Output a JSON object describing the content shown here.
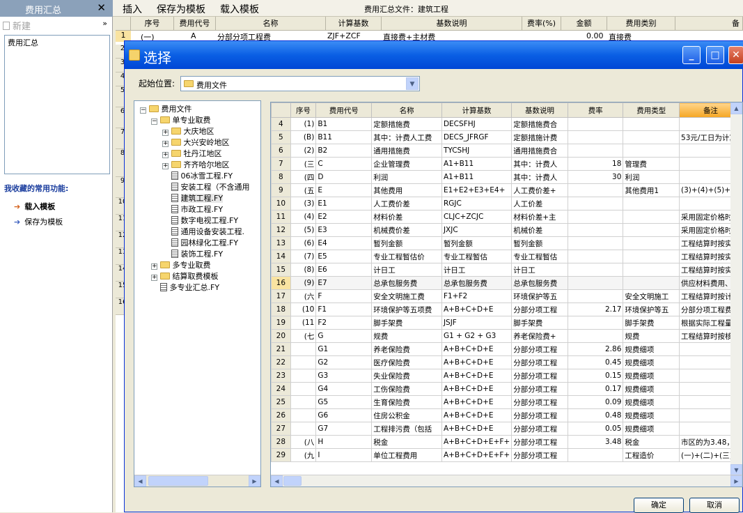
{
  "left_pane": {
    "title": "费用汇总",
    "close": "✕",
    "new_label": "新建",
    "more": "»",
    "tree_item": "费用汇总",
    "fav_title": "我收藏的常用功能:",
    "fav_items": [
      "载入模板",
      "保存为模板"
    ]
  },
  "toolbar": {
    "insert": "插入",
    "save_template": "保存为模板",
    "load_template": "载入模板",
    "doc_title": "费用汇总文件：建筑工程"
  },
  "bg_grid": {
    "headers": [
      "序号",
      "费用代号",
      "名称",
      "计算基数",
      "基数说明",
      "费率(%)",
      "金额",
      "费用类别",
      "备"
    ],
    "first_row": [
      "(一)",
      "A",
      "分部分项工程费",
      "ZJF+ZCF",
      "直接费+主材费",
      "",
      "0.00",
      "直接费"
    ],
    "row_numbers": [
      "1",
      "2",
      "3",
      "4",
      "5",
      "6",
      "7",
      "8",
      "9",
      "10",
      "11",
      "12",
      "13",
      "14",
      "15",
      "16"
    ]
  },
  "dialog": {
    "title": "选择",
    "start_label": "起始位置:",
    "start_value": "费用文件",
    "ok": "确定",
    "cancel": "取消",
    "tree": [
      {
        "label": "费用文件",
        "kind": "folder",
        "exp": "−"
      },
      {
        "label": "单专业取费",
        "kind": "folder",
        "exp": "−"
      },
      {
        "label": "大庆地区",
        "kind": "folder",
        "exp": "+"
      },
      {
        "label": "大兴安岭地区",
        "kind": "folder",
        "exp": "+"
      },
      {
        "label": "牡丹江地区",
        "kind": "folder",
        "exp": "+"
      },
      {
        "label": "齐齐哈尔地区",
        "kind": "folder",
        "exp": "+"
      },
      {
        "label": "06冰雪工程.FY",
        "kind": "file"
      },
      {
        "label": "安装工程（不含通用",
        "kind": "file"
      },
      {
        "label": "建筑工程.FY",
        "kind": "file",
        "selected": true
      },
      {
        "label": "市政工程.FY",
        "kind": "file"
      },
      {
        "label": "数字电视工程.FY",
        "kind": "file"
      },
      {
        "label": "通用设备安装工程.",
        "kind": "file"
      },
      {
        "label": "园林绿化工程.FY",
        "kind": "file"
      },
      {
        "label": "装饰工程.FY",
        "kind": "file"
      },
      {
        "label": "多专业取费",
        "kind": "folder",
        "exp": "+"
      },
      {
        "label": "结算取费模板",
        "kind": "folder",
        "exp": "+"
      },
      {
        "label": "多专业汇总.FY",
        "kind": "file"
      }
    ],
    "grid": {
      "headers": [
        "序号",
        "费用代号",
        "名称",
        "计算基数",
        "基数说明",
        "费率",
        "费用类型",
        "备注"
      ],
      "rows": [
        [
          "4",
          "(1)",
          "B1",
          "定额措施费",
          "DECSFHJ",
          "定额措施费合",
          "",
          "",
          ""
        ],
        [
          "5",
          "(B)",
          "B11",
          "其中：计费人工费",
          "DECS_JFRGF",
          "定额措施计费",
          "",
          "",
          "53元/工日为计算"
        ],
        [
          "6",
          "(2)",
          "B2",
          "通用措施费",
          "TYCSHJ",
          "通用措施费合",
          "",
          "",
          ""
        ],
        [
          "7",
          "(三",
          "C",
          "企业管理费",
          "A1+B11",
          "其中：计费人",
          "18",
          "管理费",
          ""
        ],
        [
          "8",
          "(四",
          "D",
          "利润",
          "A1+B11",
          "其中：计费人",
          "30",
          "利润",
          ""
        ],
        [
          "9",
          "(五",
          "E",
          "其他费用",
          "E1+E2+E3+E4+",
          "人工费价差+",
          "",
          "其他费用1",
          "(3)+(4)+(5)+(6"
        ],
        [
          "10",
          "(3)",
          "E1",
          "人工费价差",
          "RGJC",
          "人工价差",
          "",
          "",
          ""
        ],
        [
          "11",
          "(4)",
          "E2",
          "材料价差",
          "CLJC+ZCJC",
          "材料价差+主",
          "",
          "",
          "采用固定价格时"
        ],
        [
          "12",
          "(5)",
          "E3",
          "机械费价差",
          "JXJC",
          "机械价差",
          "",
          "",
          "采用固定价格时"
        ],
        [
          "13",
          "(6)",
          "E4",
          "暂列金额",
          "暂列金额",
          "暂列金额",
          "",
          "",
          "工程结算时按实"
        ],
        [
          "14",
          "(7)",
          "E5",
          "专业工程暂估价",
          "专业工程暂估",
          "专业工程暂估",
          "",
          "",
          "工程结算时按实"
        ],
        [
          "15",
          "(8)",
          "E6",
          "计日工",
          "计日工",
          "计日工",
          "",
          "",
          "工程结算时按实"
        ],
        [
          "16",
          "(9)",
          "E7",
          "总承包服务费",
          "总承包服务费",
          "总承包服务费",
          "",
          "",
          "供应材料费用、"
        ],
        [
          "17",
          "(六",
          "F",
          "安全文明施工费",
          "F1+F2",
          "环境保护等五",
          "",
          "安全文明施工",
          "工程结算时按计"
        ],
        [
          "18",
          "(10",
          "F1",
          "环境保护等五项费",
          "A+B+C+D+E",
          "分部分项工程",
          "2.17",
          "环境保护等五",
          "分部分项工程费"
        ],
        [
          "19",
          "(11",
          "F2",
          "脚手架费",
          "JSJF",
          "脚手架费",
          "",
          "脚手架费",
          "根据实际工程量"
        ],
        [
          "20",
          "(七",
          "G",
          "规费",
          "G1 + G2 + G3",
          "养老保险费+",
          "",
          "规费",
          "工程结算时按核"
        ],
        [
          "21",
          "",
          "G1",
          "养老保险费",
          "A+B+C+D+E",
          "分部分项工程",
          "2.86",
          "规费细项",
          ""
        ],
        [
          "22",
          "",
          "G2",
          "医疗保险费",
          "A+B+C+D+E",
          "分部分项工程",
          "0.45",
          "规费细项",
          ""
        ],
        [
          "23",
          "",
          "G3",
          "失业保险费",
          "A+B+C+D+E",
          "分部分项工程",
          "0.15",
          "规费细项",
          ""
        ],
        [
          "24",
          "",
          "G4",
          "工伤保险费",
          "A+B+C+D+E",
          "分部分项工程",
          "0.17",
          "规费细项",
          ""
        ],
        [
          "25",
          "",
          "G5",
          "生育保险费",
          "A+B+C+D+E",
          "分部分项工程",
          "0.09",
          "规费细项",
          ""
        ],
        [
          "26",
          "",
          "G6",
          "住房公积金",
          "A+B+C+D+E",
          "分部分项工程",
          "0.48",
          "规费细项",
          ""
        ],
        [
          "27",
          "",
          "G7",
          "工程排污费（包括",
          "A+B+C+D+E",
          "分部分项工程",
          "0.05",
          "规费细项",
          ""
        ],
        [
          "28",
          "(八",
          "H",
          "税金",
          "A+B+C+D+E+F+",
          "分部分项工程",
          "3.48",
          "税金",
          "市区的为3.48，"
        ],
        [
          "29",
          "(九",
          "I",
          "单位工程费用",
          "A+B+C+D+E+F+",
          "分部分项工程",
          "",
          "工程造价",
          "(一)+(二)+(三)"
        ]
      ]
    }
  }
}
